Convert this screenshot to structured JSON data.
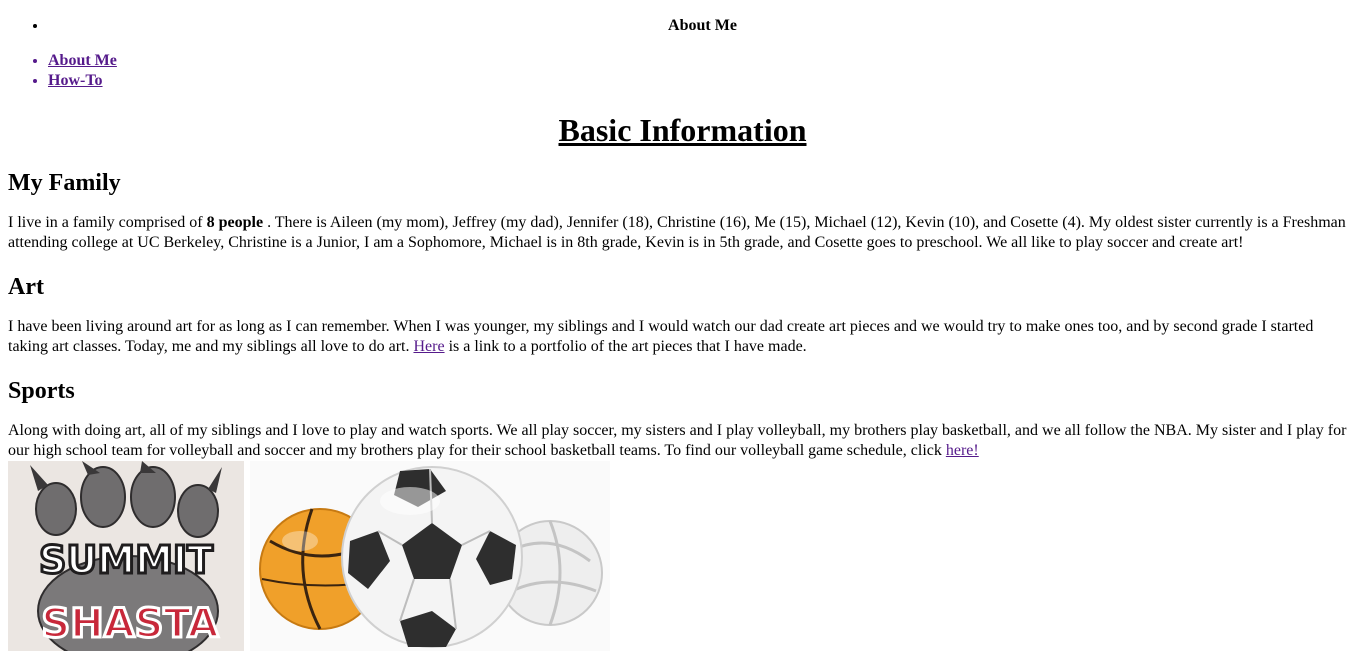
{
  "header": {
    "title": "About Me"
  },
  "nav": {
    "items": [
      {
        "label": "About Me"
      },
      {
        "label": "How-To"
      }
    ]
  },
  "main": {
    "heading": "Basic Information",
    "family": {
      "heading": "My Family",
      "text_before": "I live in a family comprised of ",
      "bold": "8 people",
      "text_after": " . There is Aileen (my mom), Jeffrey (my dad), Jennifer (18), Christine (16), Me (15), Michael (12), Kevin (10), and Cosette (4). My oldest sister currently is a Freshman attending college at UC Berkeley, Christine is a Junior, I am a Sophomore, Michael is in 8th grade, Kevin is in 5th grade, and Cosette goes to preschool. We all like to play soccer and create art!"
    },
    "art": {
      "heading": "Art",
      "text_before": "I have been living around art for as long as I can remember. When I was younger, my siblings and I would watch our dad create art pieces and we would try to make ones too, and by second grade I started taking art classes. Today, me and my siblings all love to do art. ",
      "link": "Here",
      "text_after": " is a link to a portfolio of the art pieces that I have made."
    },
    "sports": {
      "heading": "Sports",
      "text_before": "Along with doing art, all of my siblings and I love to play and watch sports. We all play soccer, my sisters and I play volleyball, my brothers play basketball, and we all follow the NBA. My sister and I play for our high school team for volleyball and soccer and my brothers play for their school basketball teams. To find our volleyball game schedule, click ",
      "link": "here!"
    },
    "images": {
      "summit_logo_text_top": "SUMMIT",
      "summit_logo_text_bottom": "SHASTA"
    }
  },
  "colors": {
    "link": "#551a8b",
    "summit_red": "#c8283a"
  }
}
